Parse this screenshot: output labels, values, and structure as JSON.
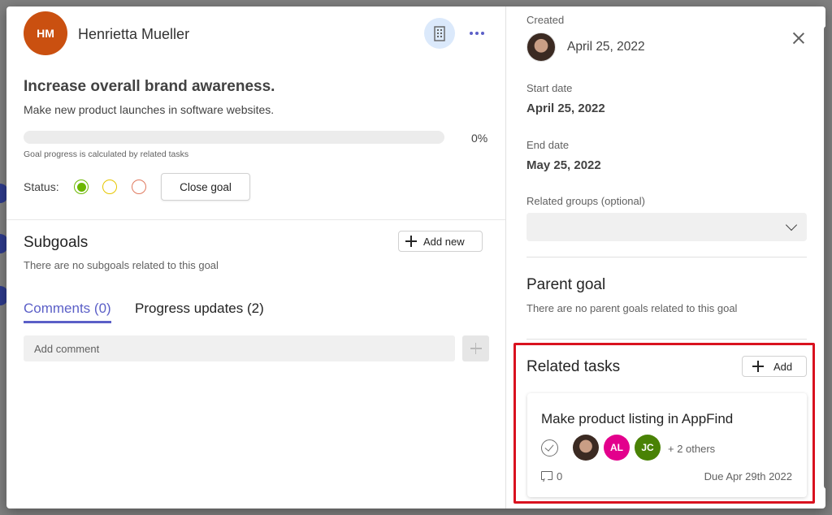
{
  "goal": {
    "owner_initials": "HM",
    "owner_name": "Henrietta Mueller",
    "title": "Increase overall brand awareness.",
    "description": "Make new product launches in software websites.",
    "progress_percent": 0,
    "progress_label": "0%",
    "progress_note": "Goal progress is calculated by related tasks",
    "status_label": "Status:",
    "status_options": [
      "on-track",
      "at-risk",
      "off-track"
    ],
    "status_selected": "on-track",
    "close_button": "Close goal"
  },
  "subgoals": {
    "title": "Subgoals",
    "add_button": "Add new",
    "empty_text": "There are no subgoals related to this goal"
  },
  "tabs": [
    {
      "label": "Comments (0)",
      "active": true
    },
    {
      "label": "Progress updates (2)",
      "active": false
    }
  ],
  "comment": {
    "placeholder": "Add comment"
  },
  "details": {
    "created_label": "Created",
    "created_date": "April 25, 2022",
    "start_label": "Start date",
    "start_date": "April 25, 2022",
    "end_label": "End date",
    "end_date": "May 25, 2022",
    "groups_label": "Related groups (optional)"
  },
  "parent_goal": {
    "title": "Parent goal",
    "empty_text": "There are no parent goals related to this goal"
  },
  "related_tasks": {
    "title": "Related tasks",
    "add_button": "Add",
    "tasks": [
      {
        "title": "Make product listing in AppFind",
        "assignees": [
          "AL",
          "JC"
        ],
        "others": "+ 2 others",
        "comment_count": "0",
        "due": "Due Apr 29th 2022"
      }
    ]
  },
  "colors": {
    "accent": "#5b5fc7",
    "owner_avatar": "#ca5010",
    "assignee_al": "#e3008c",
    "assignee_jc": "#498205",
    "status_green": "#6bb700",
    "status_yellow": "#e6c600",
    "status_red": "#e07a5f",
    "highlight": "#d9121f"
  }
}
